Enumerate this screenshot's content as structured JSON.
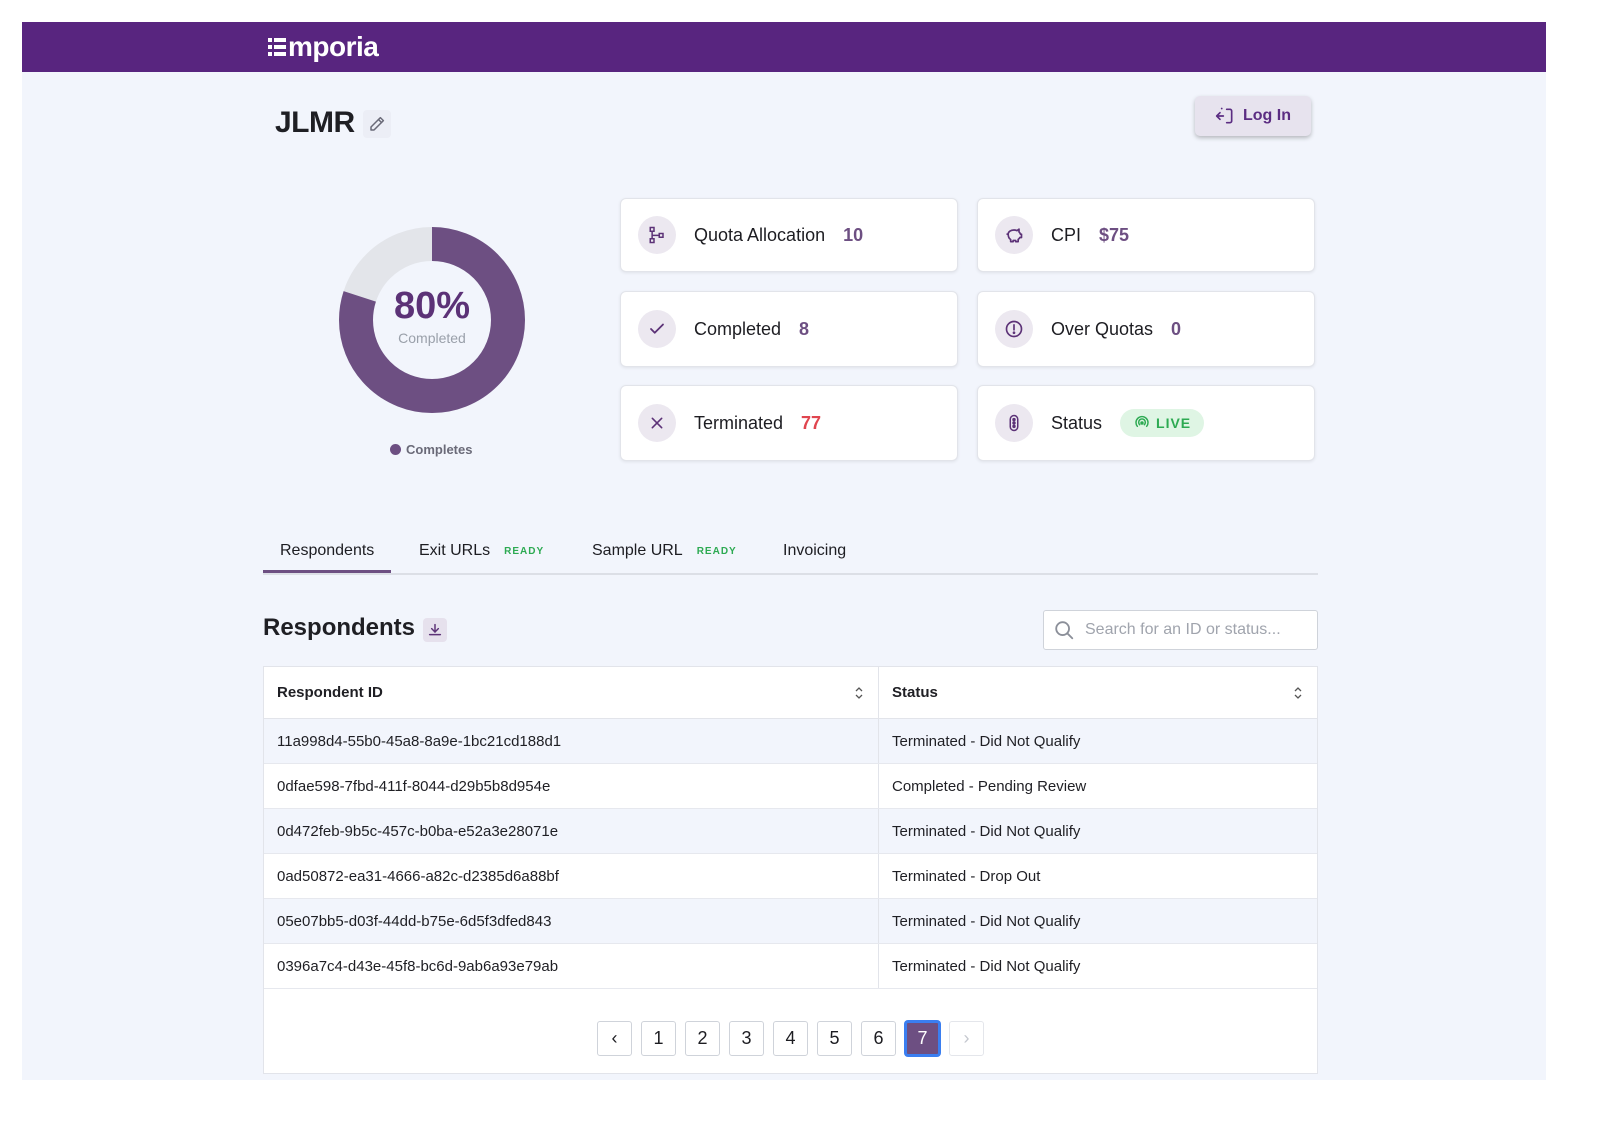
{
  "brand": {
    "name": "mporia"
  },
  "project": {
    "title": "JLMR"
  },
  "header": {
    "login_label": "Log In"
  },
  "summary": {
    "percent_label": "80%",
    "percent_sub": "Completed",
    "legend": "Completes",
    "completed_fraction": 0.8
  },
  "cards": {
    "quota": {
      "label": "Quota Allocation",
      "value": "10"
    },
    "cpi": {
      "label": "CPI",
      "value": "$75"
    },
    "completed": {
      "label": "Completed",
      "value": "8"
    },
    "over_quotas": {
      "label": "Over Quotas",
      "value": "0"
    },
    "terminated": {
      "label": "Terminated",
      "value": "77"
    },
    "status": {
      "label": "Status",
      "value": "LIVE"
    }
  },
  "tabs": [
    {
      "label": "Respondents",
      "badge": ""
    },
    {
      "label": "Exit URLs",
      "badge": "READY"
    },
    {
      "label": "Sample URL",
      "badge": "READY"
    },
    {
      "label": "Invoicing",
      "badge": ""
    }
  ],
  "respondents": {
    "title": "Respondents",
    "search_placeholder": "Search for an ID or status...",
    "columns": [
      "Respondent ID",
      "Status"
    ],
    "rows": [
      {
        "id": "11a998d4-55b0-45a8-8a9e-1bc21cd188d1",
        "status": "Terminated - Did Not Qualify"
      },
      {
        "id": "0dfae598-7fbd-411f-8044-d29b5b8d954e",
        "status": "Completed - Pending Review"
      },
      {
        "id": "0d472feb-9b5c-457c-b0ba-e52a3e28071e",
        "status": "Terminated - Did Not Qualify"
      },
      {
        "id": "0ad50872-ea31-4666-a82c-d2385d6a88bf",
        "status": "Terminated - Drop Out"
      },
      {
        "id": "05e07bb5-d03f-44dd-b75e-6d5f3dfed843",
        "status": "Terminated - Did Not Qualify"
      },
      {
        "id": "0396a7c4-d43e-45f8-bc6d-9ab6a93e79ab",
        "status": "Terminated - Did Not Qualify"
      }
    ]
  },
  "pagination": {
    "prev": "‹",
    "next": "›",
    "pages": [
      "1",
      "2",
      "3",
      "4",
      "5",
      "6",
      "7"
    ],
    "current": "7"
  },
  "colors": {
    "brand": "#58257f",
    "accent": "#6d4f82",
    "live": "#2daa52",
    "danger": "#e0454f"
  }
}
